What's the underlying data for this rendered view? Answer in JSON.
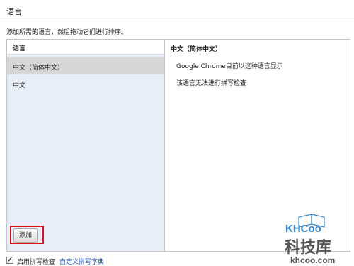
{
  "dialog": {
    "title": "语言",
    "instruction": "添加所需的语言，然后拖动它们进行排序。"
  },
  "language_list": {
    "header": "语言",
    "items": [
      {
        "label": "中文（简体中文）",
        "selected": true
      },
      {
        "label": "中文",
        "selected": false
      }
    ],
    "add_button_label": "添加"
  },
  "language_detail": {
    "title": "中文（简体中文）",
    "lines": [
      "Google Chrome目前以这种语言显示",
      "该语言无法进行拼写检查"
    ]
  },
  "footer": {
    "spellcheck_checked": true,
    "spellcheck_label": "启用拼写检查",
    "custom_dictionary_link": "自定义拼写字典"
  },
  "watermark": {
    "logo_text": "KHCoo",
    "site": "khcoo.com",
    "brand": "科技库"
  },
  "colors": {
    "highlight_border": "#d4141c",
    "list_background": "#e8eef7",
    "selected_row": "#d6d6d6",
    "link": "#1a4fb5",
    "watermark_blue": "#3a86c8",
    "watermark_text": "#555555"
  }
}
